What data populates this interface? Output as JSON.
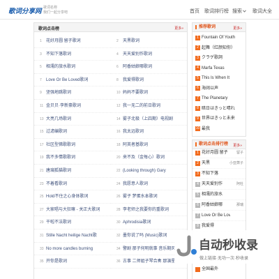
{
  "colors": {
    "brand": "#1d5fae",
    "accent": "#f26b1d",
    "more": "#cc3333"
  },
  "header": {
    "logo": "歌词分享网",
    "tagline1": "歌词名称",
    "tagline2": "我们一起分享吧",
    "nav": [
      {
        "label": "首页"
      },
      {
        "label": "歌词排行榜"
      },
      {
        "label": "搜索",
        "icon": "chevron-down-icon"
      },
      {
        "label": "歌词大全"
      }
    ]
  },
  "main": {
    "title": "歌词点击榜",
    "more": "更多»",
    "items": [
      {
        "num": "1",
        "title": "花好月圆 留子歌词"
      },
      {
        "num": "2",
        "title": "天黑歌词"
      },
      {
        "num": "3",
        "title": "不知下落歌词"
      },
      {
        "num": "4",
        "title": "天天爱别作歌词"
      },
      {
        "num": "5",
        "title": "相濡的旅水歌词"
      },
      {
        "num": "6",
        "title": "阿香姑娘哪歌词"
      },
      {
        "num": "7",
        "title": "Love Or Be Loved歌词"
      },
      {
        "num": "8",
        "title": "我爱得歌词"
      },
      {
        "num": "9",
        "title": "坚强地跳歌词"
      },
      {
        "num": "10",
        "title": "妈妈不要歌词"
      },
      {
        "num": "11",
        "title": "金贝贝·李新豪歌词"
      },
      {
        "num": "12",
        "title": "我一无二的前日歌词"
      },
      {
        "num": "13",
        "title": "大亮几场歌词"
      },
      {
        "num": "14",
        "title": "雾子北极（上四期）电视剧"
      },
      {
        "num": "15",
        "title": "过滤编歌词"
      },
      {
        "num": "16",
        "title": "我太远歌词"
      },
      {
        "num": "17",
        "title": "社区型佛歌歌词"
      },
      {
        "num": "18",
        "title": "阿英者基歌词"
      },
      {
        "num": "19",
        "title": "我不多情歌歌词"
      },
      {
        "num": "20",
        "title": "来不及（金每心）歌词"
      },
      {
        "num": "21",
        "title": "唐璃狐猫歌词"
      },
      {
        "num": "22",
        "title": "(Looking through) Gary"
      },
      {
        "num": "23",
        "title": "不着看歌词"
      },
      {
        "num": "24",
        "title": "我愿意人歌词"
      },
      {
        "num": "25",
        "title": "Hold不住之心身体歌词"
      },
      {
        "num": "26",
        "title": "雾子 梦蛋水本歌词"
      },
      {
        "num": "27",
        "title": "大家唱与大狂嘛 - 关正大歌词"
      },
      {
        "num": "28",
        "title": "李老师之我要你的重歌词"
      },
      {
        "num": "29",
        "title": "干啦不法歌词"
      },
      {
        "num": "30",
        "title": "Aphrodisia歌词"
      },
      {
        "num": "31",
        "title": "Stille Nacht heilige Nacht歌"
      },
      {
        "num": "32",
        "title": "墨你说了吗 (Music)歌词"
      },
      {
        "num": "33",
        "title": "No more candles burning"
      },
      {
        "num": "34",
        "title": "警剧 那子何明就事 音乐期风"
      },
      {
        "num": "35",
        "title": "开你是歌词"
      },
      {
        "num": "36",
        "title": "古事 二师姐子琴合奏 那演星"
      }
    ]
  },
  "sidebar": {
    "recommend": {
      "title": "推荐歌词",
      "more": "更多»",
      "items": [
        {
          "num": "1",
          "title": "Fountain Of Youth"
        },
        {
          "num": "2",
          "title": "起舞（红颜知你）"
        },
        {
          "num": "3",
          "title": "クラゲ歌詞"
        },
        {
          "num": "4",
          "title": "Marfa Texas"
        },
        {
          "num": "5",
          "title": "This Is When It"
        },
        {
          "num": "6",
          "title": "海阔以声"
        },
        {
          "num": "7",
          "title": "The Planetary"
        },
        {
          "num": "8",
          "title": "暗日はきっと晴れ"
        },
        {
          "num": "9",
          "title": "世界はきっと未来"
        },
        {
          "num": "10",
          "title": "最我"
        }
      ]
    },
    "rank": {
      "title": "歌词点击排行榜",
      "more": "更多»",
      "items": [
        {
          "num": "1",
          "title": "花好月圆 留子",
          "artist": "留子"
        },
        {
          "num": "2",
          "title": "天黑",
          "artist": "小亚萧子"
        },
        {
          "num": "3",
          "title": "不知下落"
        },
        {
          "num": "4",
          "title": "天天爱别作",
          "artist": "阿杜"
        },
        {
          "num": "5",
          "title": "相濡的旅水"
        },
        {
          "num": "6",
          "title": "阿香姑娘哪",
          "artist": "那瑞"
        },
        {
          "num": "7",
          "title": "Love Or Be Loved"
        },
        {
          "num": "8",
          "title": "我爱得"
        }
      ],
      "tail": {
        "title": "全国最外"
      }
    }
  },
  "watermark": {
    "title": "自动秒收录",
    "subtitle": "做上链接·无功一次·秒收录",
    "icon": "watermark-logo-icon"
  }
}
